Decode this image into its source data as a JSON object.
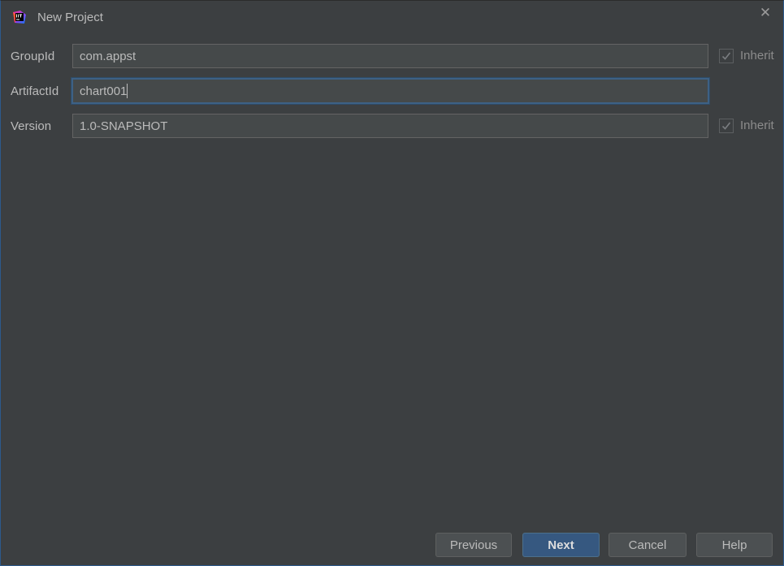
{
  "window": {
    "title": "New Project",
    "close_glyph": "✕",
    "app_icon": "intellij-idea-icon"
  },
  "fields": {
    "group_id": {
      "label": "GroupId",
      "value": "com.appst",
      "inherit_label": "Inherit",
      "inherit_checked": true
    },
    "artifact_id": {
      "label": "ArtifactId",
      "value": "chart001"
    },
    "version": {
      "label": "Version",
      "value": "1.0-SNAPSHOT",
      "inherit_label": "Inherit",
      "inherit_checked": true
    }
  },
  "buttons": {
    "previous": "Previous",
    "next": "Next",
    "cancel": "Cancel",
    "help": "Help"
  },
  "colors": {
    "background": "#3c3f41",
    "field_background": "#45494a",
    "focus_border": "#3d6185",
    "default_button": "#365880",
    "text": "#bbbbbb"
  }
}
